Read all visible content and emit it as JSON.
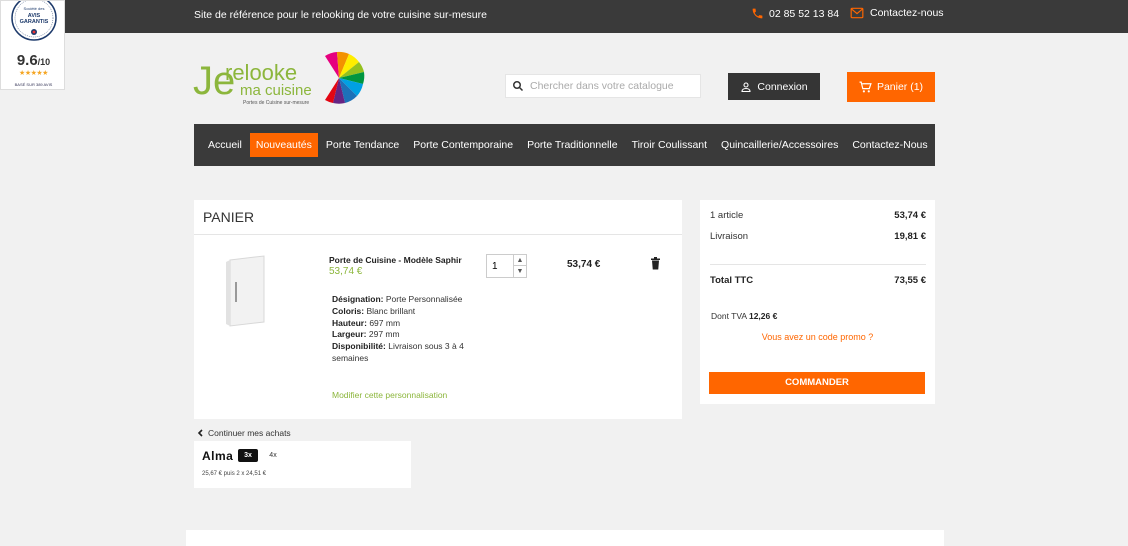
{
  "topbar": {
    "tagline": "Site de référence pour le relooking de votre cuisine sur-mesure",
    "phone": "02 85 52 13 84",
    "contact": "Contactez-nous",
    "phone_icon": "phone-icon",
    "mail_icon": "mail-icon"
  },
  "badge": {
    "seal_line1": "Société des",
    "seal_line2": "AVIS",
    "seal_line3": "GARANTIS",
    "score": "9.6",
    "score_suffix": "/10",
    "stars": "★★★★★",
    "based_on": "BASÉ SUR 389 AVIS"
  },
  "logo": {
    "line1_je": "Je",
    "line1_rest": "relooke",
    "line2": "ma cuisine",
    "tagline": "Portes de Cuisine sur-mesure"
  },
  "header": {
    "search_placeholder": "Chercher dans votre catalogue",
    "login_label": "Connexion",
    "cart_label": "Panier (1)"
  },
  "nav": {
    "items": [
      {
        "label": "Accueil",
        "active": false
      },
      {
        "label": "Nouveautés",
        "active": true
      },
      {
        "label": "Porte Tendance",
        "active": false
      },
      {
        "label": "Porte Contemporaine",
        "active": false
      },
      {
        "label": "Porte Traditionnelle",
        "active": false
      },
      {
        "label": "Tiroir Coulissant",
        "active": false
      },
      {
        "label": "Quincaillerie/Accessoires",
        "active": false
      },
      {
        "label": "Contactez-Nous",
        "active": false
      }
    ]
  },
  "cart": {
    "title": "PANIER",
    "product": {
      "name": "Porte de Cuisine - Modèle Saphir",
      "price": "53,74 €",
      "quantity": "1",
      "line_total": "53,74 €",
      "details": [
        {
          "label": "Désignation:",
          "value": "Porte Personnalisée"
        },
        {
          "label": "Coloris:",
          "value": "Blanc brillant"
        },
        {
          "label": "Hauteur:",
          "value": "697 mm"
        },
        {
          "label": "Largeur:",
          "value": "297 mm"
        },
        {
          "label": "Disponibilité:",
          "value": "Livraison sous 3 à 4 semaines"
        }
      ],
      "modify_label": "Modifier cette personnalisation"
    },
    "continue_label": "Continuer mes achats"
  },
  "alma": {
    "logo": "Alma",
    "option_3x": "3x",
    "option_4x": "4x",
    "schedule": "25,67 € puis 2 x 24,51 €"
  },
  "summary": {
    "articles_label": "1 article",
    "articles_value": "53,74 €",
    "shipping_label": "Livraison",
    "shipping_value": "19,81 €",
    "total_label": "Total TTC",
    "total_value": "73,55 €",
    "tva_label": "Dont TVA",
    "tva_value": "12,26 €",
    "promo_label": "Vous avez un code promo ?",
    "order_label": "COMMANDER"
  },
  "colors": {
    "accent": "#ff6600",
    "dark": "#3a3a3a",
    "green": "#8cb63c"
  }
}
